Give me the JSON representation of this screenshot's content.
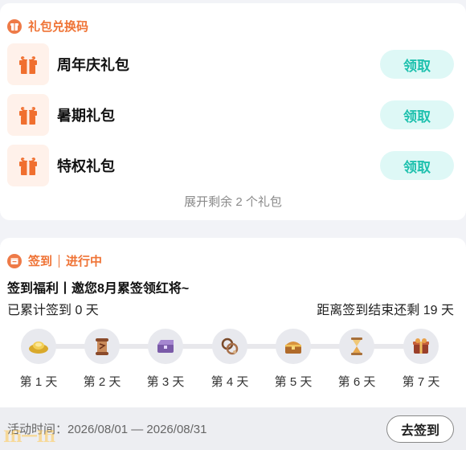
{
  "gift_section": {
    "title": "礼包兑换码",
    "items": [
      {
        "name": "周年庆礼包",
        "button": "领取"
      },
      {
        "name": "暑期礼包",
        "button": "领取"
      },
      {
        "name": "特权礼包",
        "button": "领取"
      }
    ],
    "expand_label": "展开剩余 2 个礼包"
  },
  "signin_section": {
    "title": "签到",
    "status": "进行中",
    "headline": "签到福利丨邀您8月累签领红将~",
    "accumulated": "已累计签到 0 天",
    "remaining": "距离签到结束还剩 19 天",
    "days": [
      {
        "label": "第 1 天",
        "icon": "gold-ingot-icon"
      },
      {
        "label": "第 2 天",
        "icon": "scroll-icon"
      },
      {
        "label": "第 3 天",
        "icon": "purple-chest-icon"
      },
      {
        "label": "第 4 天",
        "icon": "chain-amulet-icon"
      },
      {
        "label": "第 5 天",
        "icon": "treasure-chest-icon"
      },
      {
        "label": "第 6 天",
        "icon": "hourglass-icon"
      },
      {
        "label": "第 7 天",
        "icon": "reward-box-icon"
      }
    ],
    "activity_time": "活动时间：2026/08/01 — 2026/08/31",
    "go_button": "去签到"
  },
  "watermark": "Ifi一Ifi",
  "colors": {
    "accent_orange": "#ef7335",
    "claim_text": "#1fc1ae",
    "claim_bg": "#def8f6"
  }
}
